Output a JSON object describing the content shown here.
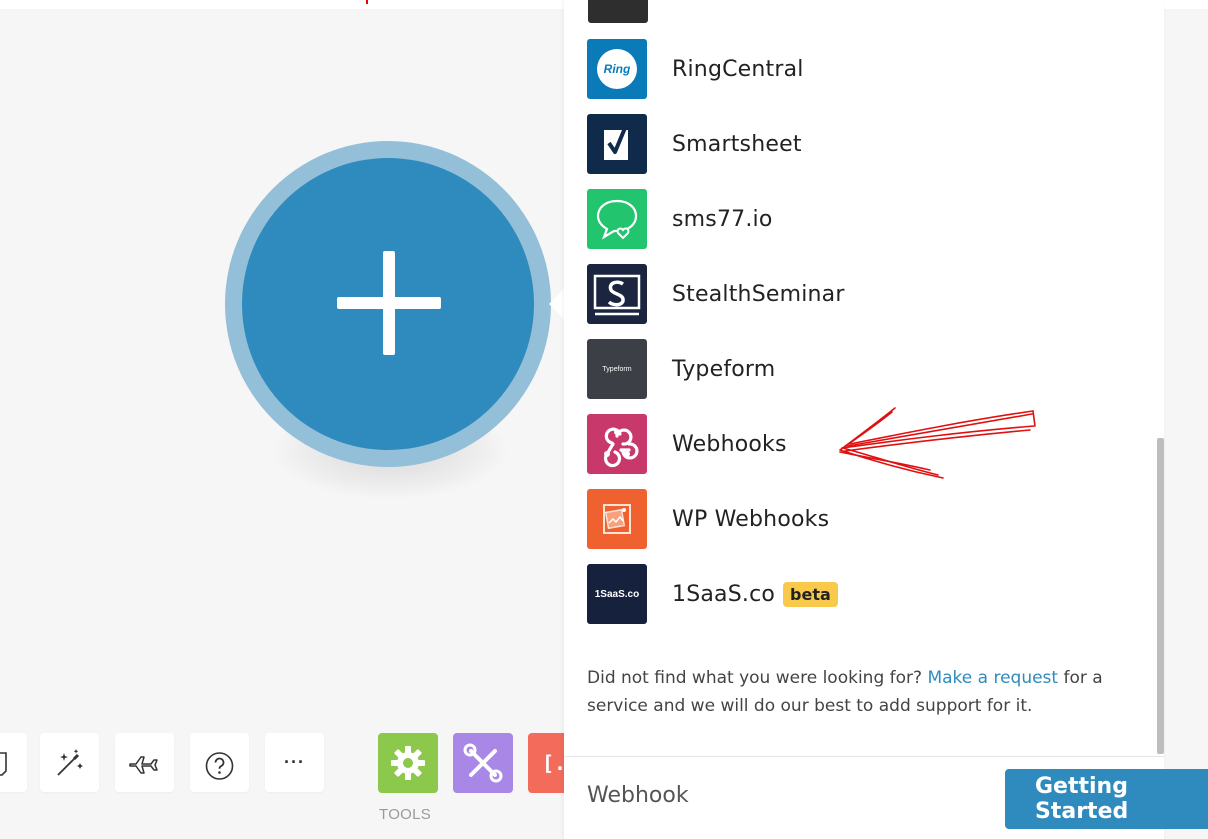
{
  "canvas": {
    "module_color": "#2f8bbd",
    "module_ring_color": "#93bfd9",
    "add_icon": "plus-icon"
  },
  "toolbar": {
    "buttons": [
      {
        "icon": "notes-icon"
      },
      {
        "icon": "magic-wand-icon"
      },
      {
        "icon": "airplane-icon"
      },
      {
        "icon": "help-icon"
      },
      {
        "icon": "more-icon",
        "label": "···"
      }
    ],
    "tools_label": "TOOLS",
    "tools": [
      {
        "icon": "gear-icon",
        "color": "#8cc84b"
      },
      {
        "icon": "tools-icon",
        "color": "#a987e6"
      },
      {
        "icon": "text-parser-icon",
        "color": "#f26b5b"
      }
    ]
  },
  "panel": {
    "apps": [
      {
        "name": "RingCentral",
        "icon": "ringcentral-icon",
        "color": "#0a7ab8",
        "icon_text": "Ring"
      },
      {
        "name": "Smartsheet",
        "icon": "smartsheet-icon",
        "color": "#102a4c"
      },
      {
        "name": "sms77.io",
        "icon": "sms77-icon",
        "color": "#22c46e"
      },
      {
        "name": "StealthSeminar",
        "icon": "stealthseminar-icon",
        "color": "#1b2540"
      },
      {
        "name": "Typeform",
        "icon": "typeform-icon",
        "color": "#3c3f45",
        "icon_text": "Typeform"
      },
      {
        "name": "Webhooks",
        "icon": "webhooks-icon",
        "color": "#c9386a"
      },
      {
        "name": "WP Webhooks",
        "icon": "wp-webhooks-icon",
        "color": "#f06130"
      },
      {
        "name": "1SaaS.co",
        "icon": "1saas-icon",
        "color": "#15213d",
        "icon_text": "1SaaS.co",
        "badge": "beta"
      }
    ],
    "not_found_prefix": "Did not find what you were looking for? ",
    "make_request_link": "Make a request",
    "not_found_suffix": " for a service and we will do our best to add support for it.",
    "search_value": "Webhook"
  },
  "getting_started": {
    "label": "Getting Started",
    "color": "#2f8bbd"
  }
}
